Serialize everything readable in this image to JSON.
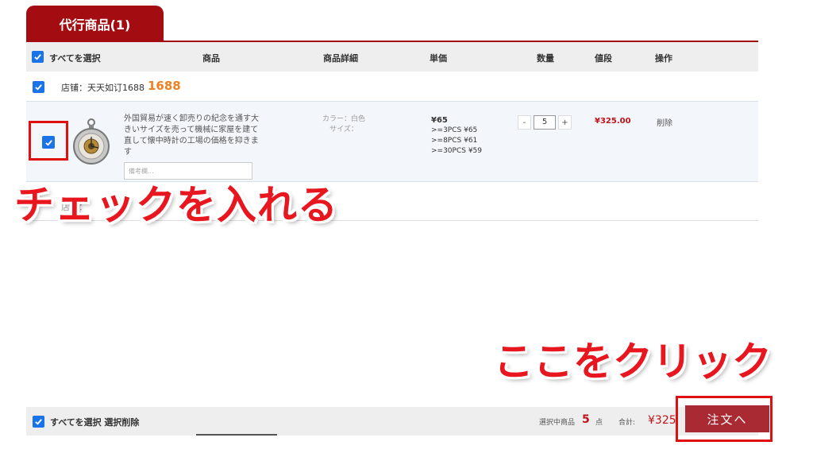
{
  "tab": {
    "label": "代行商品(1)"
  },
  "header": {
    "select_all": "すべてを選択",
    "columns": [
      "商品",
      "商品詳細",
      "単価",
      "数量",
      "値段",
      "操作"
    ]
  },
  "shop": {
    "name": "店铺：天天如订1688",
    "badge": "1688"
  },
  "item": {
    "title": "外国貿易が速く卸売りの紀念を通す大きいサイズを売って機械に家屋を建て直して懐中時計の工場の価格を抑きます",
    "memo_placeholder": "備考欄...",
    "detail_color": "カラー：白色",
    "detail_size": "サイズ：",
    "price_main": "¥65",
    "price_tiers": [
      ">=3PCS ¥65",
      ">=8PCS ¥61",
      ">=30PCS ¥59"
    ],
    "qty_minus": "-",
    "qty_value": "5",
    "qty_plus": "+",
    "amount": "¥325.00",
    "delete": "削除"
  },
  "shop2": {
    "label": "店铺："
  },
  "annotations": {
    "check": "チェックを入れる",
    "click": "ここをクリック"
  },
  "footer": {
    "select_all": "すべてを選択 選択削除",
    "selected_label": "選択中商品",
    "selected_count": "5",
    "selected_unit": "点",
    "total_label": "合計:",
    "total": "¥325",
    "order_button": "注文へ"
  },
  "colors": {
    "brand": "#a30d12",
    "checkbox": "#1a73e8",
    "annotation": "#e8161e",
    "price": "#c0141a"
  }
}
